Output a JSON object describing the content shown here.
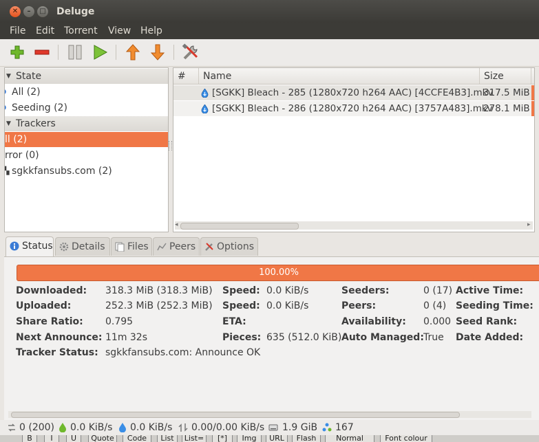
{
  "window": {
    "title": "Deluge"
  },
  "menu": [
    "File",
    "Edit",
    "Torrent",
    "View",
    "Help"
  ],
  "toolbar": {
    "icons": [
      "add-icon",
      "remove-icon",
      "pause-icon",
      "resume-icon",
      "queue-up-icon",
      "queue-down-icon",
      "preferences-icon"
    ]
  },
  "sidebar": {
    "state_header": "State",
    "state_items": [
      "All (2)",
      "Seeding (2)"
    ],
    "trackers_header": "Trackers",
    "tracker_items": [
      "ll (2)",
      "rror (0)",
      "sgkkfansubs.com (2)"
    ]
  },
  "torrents": {
    "columns": [
      "#",
      "Name",
      "Size"
    ],
    "rows": [
      {
        "name": "[SGKK] Bleach - 285 (1280x720 h264 AAC) [4CCFE4B3].mkv",
        "size": "317.5 MiB"
      },
      {
        "name": "[SGKK] Bleach - 286 (1280x720 h264 AAC) [3757A483].mkv",
        "size": "278.1 MiB"
      }
    ]
  },
  "tabs": [
    "Status",
    "Details",
    "Files",
    "Peers",
    "Options"
  ],
  "status": {
    "progress_text": "100.00%",
    "progress_fraction": 1.0,
    "col1": {
      "downloaded_label": "Downloaded:",
      "downloaded_value": "318.3 MiB (318.3 MiB)",
      "uploaded_label": "Uploaded:",
      "uploaded_value": "252.3 MiB (252.3 MiB)",
      "ratio_label": "Share Ratio:",
      "ratio_value": "0.795",
      "next_label": "Next Announce:",
      "next_value": "11m 32s",
      "tracker_label": "Tracker Status:",
      "tracker_value": "sgkkfansubs.com: Announce OK"
    },
    "col2": {
      "dspeed_label": "Speed:",
      "dspeed_value": "0.0 KiB/s",
      "uspeed_label": "Speed:",
      "uspeed_value": "0.0 KiB/s",
      "eta_label": "ETA:",
      "pieces_label": "Pieces:",
      "pieces_value": "635 (512.0 KiB)"
    },
    "col3": {
      "seeders_label": "Seeders:",
      "seeders_value": "0 (17)",
      "peers_label": "Peers:",
      "peers_value": "0 (4)",
      "avail_label": "Availability:",
      "avail_value": "0.000",
      "auto_label": "Auto Managed:",
      "auto_value": "True"
    },
    "col4": {
      "active_label": "Active Time:",
      "seeding_label": "Seeding Time:",
      "rank_label": "Seed Rank:",
      "added_label": "Date Added:"
    }
  },
  "statusbar": {
    "connections": "0 (200)",
    "download": "0.0 KiB/s",
    "upload": "0.0 KiB/s",
    "protocol": "0.00/0.00 KiB/s",
    "disk": "1.9 GiB",
    "dht": "167"
  },
  "background_strip": [
    "B",
    "I",
    "U",
    "Quote",
    "Code",
    "List",
    "List=",
    "[*]",
    "Img",
    "URL",
    "Flash",
    "Normal",
    "Font colour"
  ],
  "colors": {
    "accent": "#f07746",
    "titlebar": "#3c3b37",
    "close": "#e4541f"
  }
}
